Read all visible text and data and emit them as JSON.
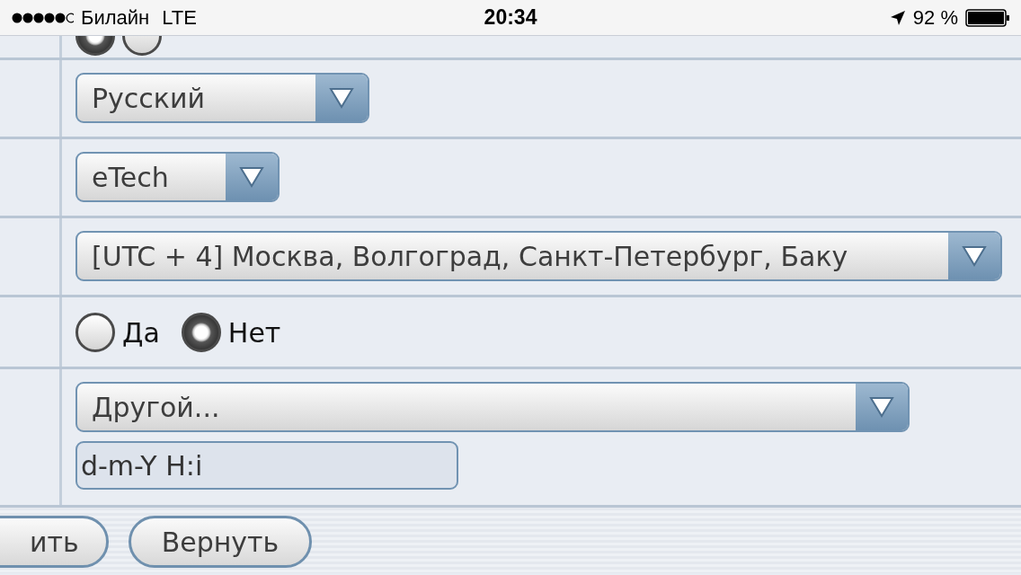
{
  "status_bar": {
    "carrier": "Билайн",
    "network": "LTE",
    "time": "20:34",
    "battery": "92 %"
  },
  "rows": [
    {
      "kind": "radio",
      "options": [
        {
          "selected": true
        },
        {
          "selected": false
        }
      ]
    },
    {
      "kind": "select",
      "value": "Русский"
    },
    {
      "kind": "select",
      "value": "eTech"
    },
    {
      "kind": "select",
      "value": "[UTC + 4] Москва, Волгоград, Санкт-Петербург, Баку"
    },
    {
      "kind": "radio",
      "options": [
        {
          "label": "Да",
          "selected": false
        },
        {
          "label": "Нет",
          "selected": true
        }
      ]
    },
    {
      "kind": "select_input",
      "value": "Другой...",
      "input": "d-m-Y H:i"
    }
  ],
  "buttons": [
    "ить",
    "Вернуть"
  ]
}
